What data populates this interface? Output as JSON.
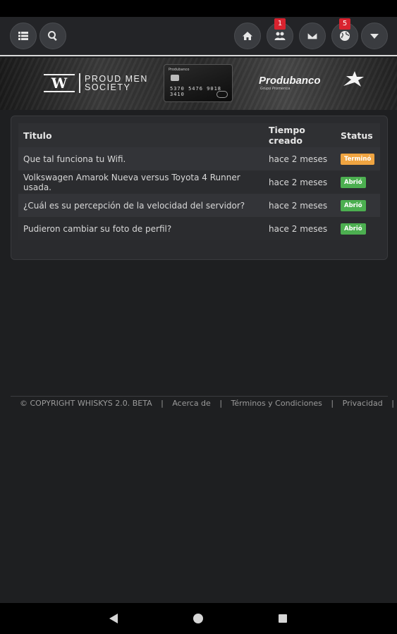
{
  "navbar": {
    "left_buttons": [
      {
        "icon": "list-icon",
        "label": "Menu"
      },
      {
        "icon": "search-icon",
        "label": "Buscar"
      }
    ],
    "right_buttons": [
      {
        "icon": "home-icon",
        "badge": null
      },
      {
        "icon": "users-icon",
        "badge": "1"
      },
      {
        "icon": "envelope-icon",
        "badge": null
      },
      {
        "icon": "globe-icon",
        "badge": "5"
      },
      {
        "icon": "caret-down-icon",
        "badge": null
      }
    ],
    "badge_color": "#d9232f"
  },
  "banner": {
    "sponsor1_mark": "W",
    "sponsor1_line1": "PROUD MEN",
    "sponsor1_line2": "SOCIETY",
    "card_brand": "Produbanco",
    "card_numbers": "5370 5476 9018 3410",
    "sponsor2_name": "Produbanco",
    "sponsor2_tagline": "Grupo Promerica"
  },
  "table": {
    "headers": {
      "title": "Titulo",
      "time": "Tiempo creado",
      "status": "Status"
    },
    "rows": [
      {
        "title": "Que tal funciona tu Wifi.",
        "time": "hace 2 meses",
        "status": "Terminó",
        "status_type": "closed"
      },
      {
        "title": "Volkswagen Amarok Nueva versus Toyota 4 Runner usada.",
        "time": "hace 2 meses",
        "status": "Abrió",
        "status_type": "open"
      },
      {
        "title": "¿Cuál es su percepción de la velocidad del servidor?",
        "time": "hace 2 meses",
        "status": "Abrió",
        "status_type": "open"
      },
      {
        "title": "Pudieron cambiar su foto de perfil?",
        "time": "hace 2 meses",
        "status": "Abrió",
        "status_type": "open"
      }
    ],
    "status_colors": {
      "closed": "#f0a441",
      "open": "#4caf50"
    }
  },
  "footer": {
    "copyright": "© COPYRIGHT WHISKYS 2.0. BETA",
    "links": [
      "Acerca de",
      "Términos y Condiciones",
      "Privacidad"
    ],
    "separator": "|"
  },
  "android_nav": {
    "back_icon": "back-triangle-icon",
    "home_icon": "home-circle-icon",
    "recents_icon": "recents-square-icon"
  }
}
